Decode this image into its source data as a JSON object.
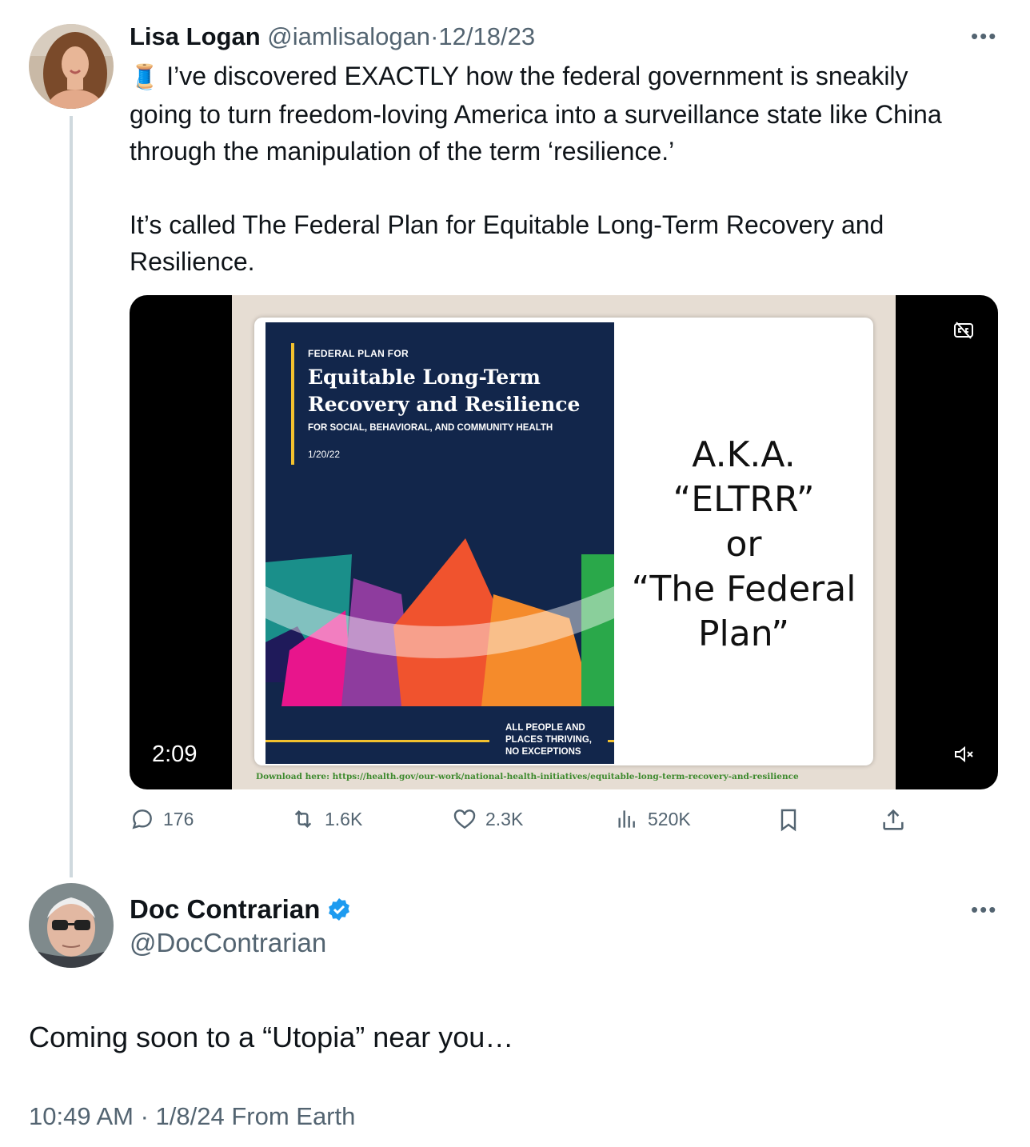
{
  "colors": {
    "text": "#0f1419",
    "muted": "#536471",
    "verified": "#1d9bf0",
    "border": "#cfd9de",
    "cover_navy": "#12264b",
    "accent_yellow": "#f2c12e"
  },
  "tweet1": {
    "author_name": "Lisa Logan",
    "handle": "@iamlisalogan",
    "separator": "·",
    "date": "12/18/23",
    "emoji": "🧵",
    "text_p1": "I’ve discovered EXACTLY how the federal government is sneakily going to turn freedom-loving America into a surveillance state like China through the manipulation of the term ‘resilience.’",
    "text_p2": "It’s called The Federal Plan for Equitable Long-Term Recovery and Resilience.",
    "more_icon": "more-horizontal-icon",
    "video": {
      "duration": "2:09",
      "captions_icon": "captions-off-icon",
      "mute_icon": "volume-muted-icon",
      "cover": {
        "kicker": "FEDERAL PLAN FOR",
        "title_line1": "Equitable Long-Term",
        "title_line2": "Recovery and Resilience",
        "subtitle": "FOR SOCIAL, BEHAVIORAL, AND COMMUNITY HEALTH",
        "date": "1/20/22",
        "footer_line1": "ALL PEOPLE AND",
        "footer_line2": "PLACES THRIVING,",
        "footer_line3": "NO EXCEPTIONS"
      },
      "aka_line1": "A.K.A.",
      "aka_line2": "“ELTRR”",
      "aka_line3": "or",
      "aka_line4": "“The Federal",
      "aka_line5": "Plan”",
      "download_text": "Download here: https://health.gov/our-work/national-health-initiatives/equitable-long-term-recovery-and-resilience"
    },
    "actions": {
      "replies": "176",
      "reposts": "1.6K",
      "likes": "2.3K",
      "views": "520K"
    }
  },
  "tweet2": {
    "author_name": "Doc Contrarian",
    "handle": "@DocContrarian",
    "verified": true,
    "text": "Coming soon to a “Utopia” near you…",
    "timestamp": "10:49 AM · 1/8/24 From Earth",
    "more_icon": "more-horizontal-icon"
  }
}
